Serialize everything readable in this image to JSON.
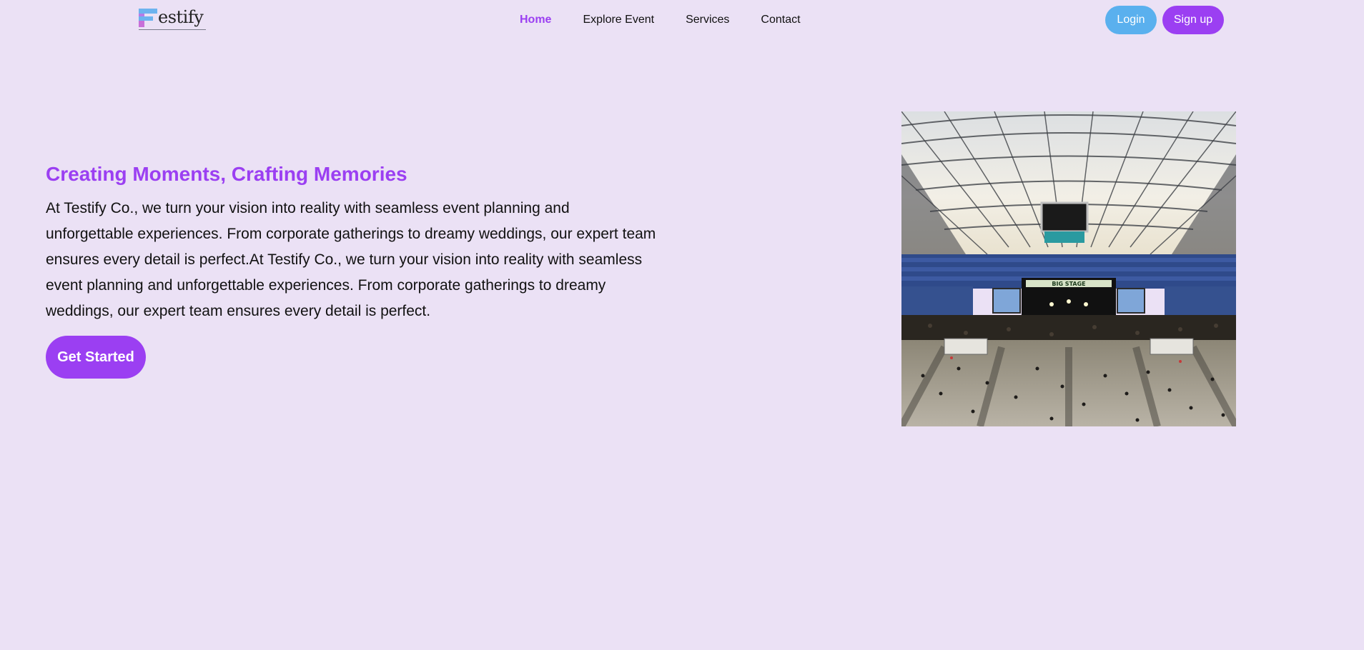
{
  "brand": {
    "name": "estify",
    "accent": "#9b3ff2",
    "login_color": "#5ab0ee",
    "background": "#ebe1f5"
  },
  "nav": {
    "links": [
      {
        "label": "Home",
        "active": true
      },
      {
        "label": "Explore Event",
        "active": false
      },
      {
        "label": "Services",
        "active": false
      },
      {
        "label": "Contact",
        "active": false
      }
    ],
    "login_label": "Login",
    "signup_label": "Sign up"
  },
  "hero": {
    "title": "Creating Moments, Crafting Memories",
    "text": "At Testify Co., we turn your vision into reality with seamless event planning and unforgettable experiences. From corporate gatherings to dreamy weddings, our expert team ensures every detail is perfect.At Testify Co., we turn your vision into reality with seamless event planning and unforgettable experiences. From corporate gatherings to dreamy weddings, our expert team ensures every detail is perfect.",
    "cta_label": "Get Started",
    "image_stage_sign": "BIG STAGE"
  }
}
